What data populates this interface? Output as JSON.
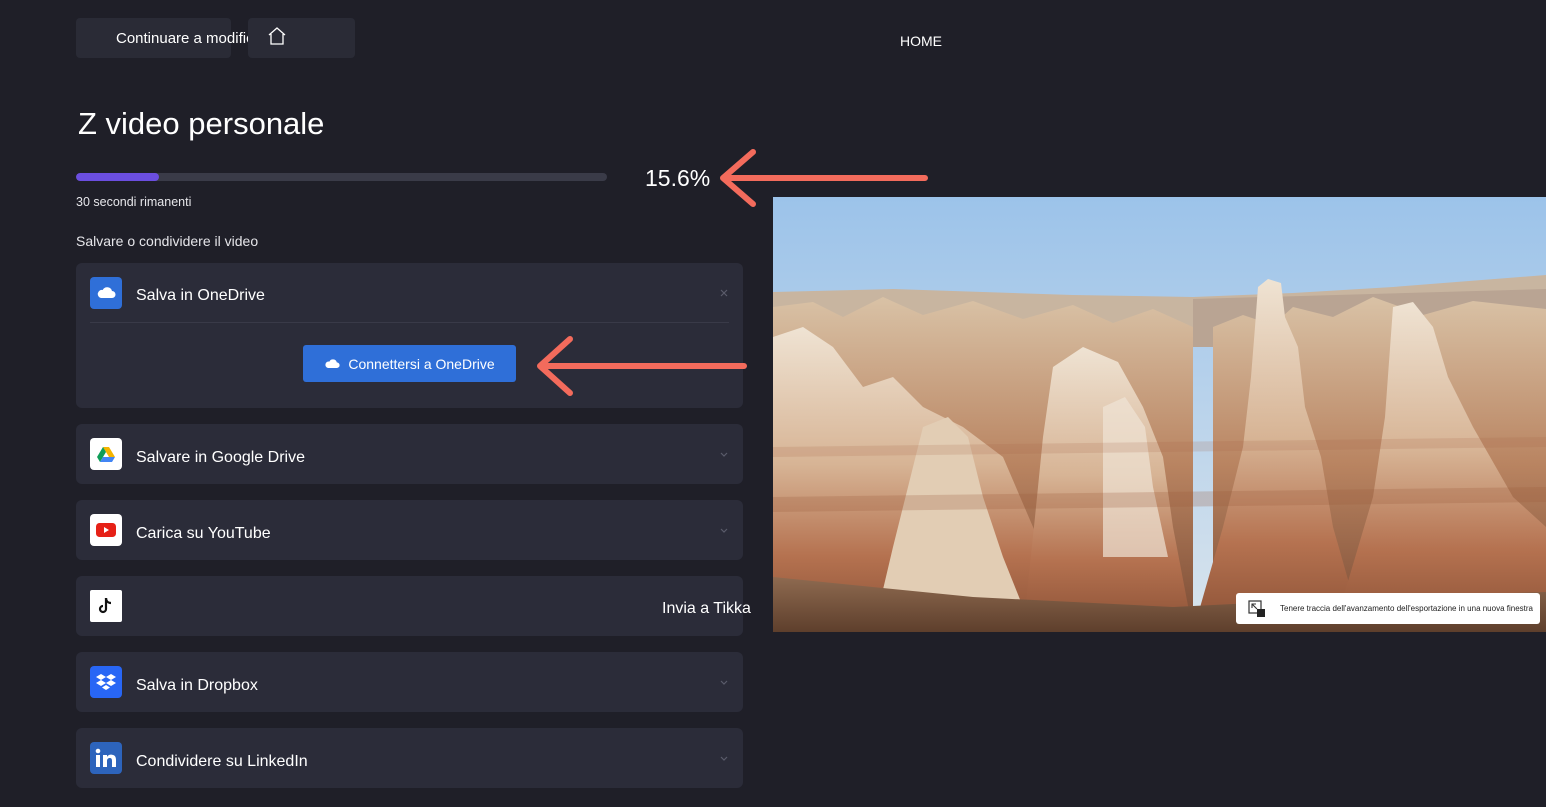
{
  "top": {
    "back_label": "Continuare a modificare",
    "home_label": "HOME"
  },
  "title": "Z video personale",
  "progress": {
    "percent_text": "15.6%",
    "value": 0.156,
    "remaining_text": "30 secondi rimanenti"
  },
  "section_label": "Salvare o condividere il video",
  "destinations": [
    {
      "label": "Salva in OneDrive",
      "icon": "onedrive-icon",
      "expanded": true
    },
    {
      "label": "Salvare in Google Drive",
      "icon": "google-drive-icon"
    },
    {
      "label": "Carica su YouTube",
      "icon": "youtube-icon"
    },
    {
      "label": "Invia a Tikka",
      "icon": "tiktok-icon"
    },
    {
      "label": "Salva in Dropbox",
      "icon": "dropbox-icon"
    },
    {
      "label": "Condividere su LinkedIn",
      "icon": "linkedin-icon"
    }
  ],
  "onedrive": {
    "connect_label": "Connettersi a OneDrive"
  },
  "preview": {
    "toast_text": "Tenere traccia dell'avanzamento dell'esportazione in una nuova finestra"
  },
  "colors": {
    "background": "#1f1f28",
    "card": "#2b2c39",
    "progress_fill": "#6b4ee0",
    "connect_button": "#2f6fd8",
    "annotation_arrow": "#f36b5c"
  }
}
